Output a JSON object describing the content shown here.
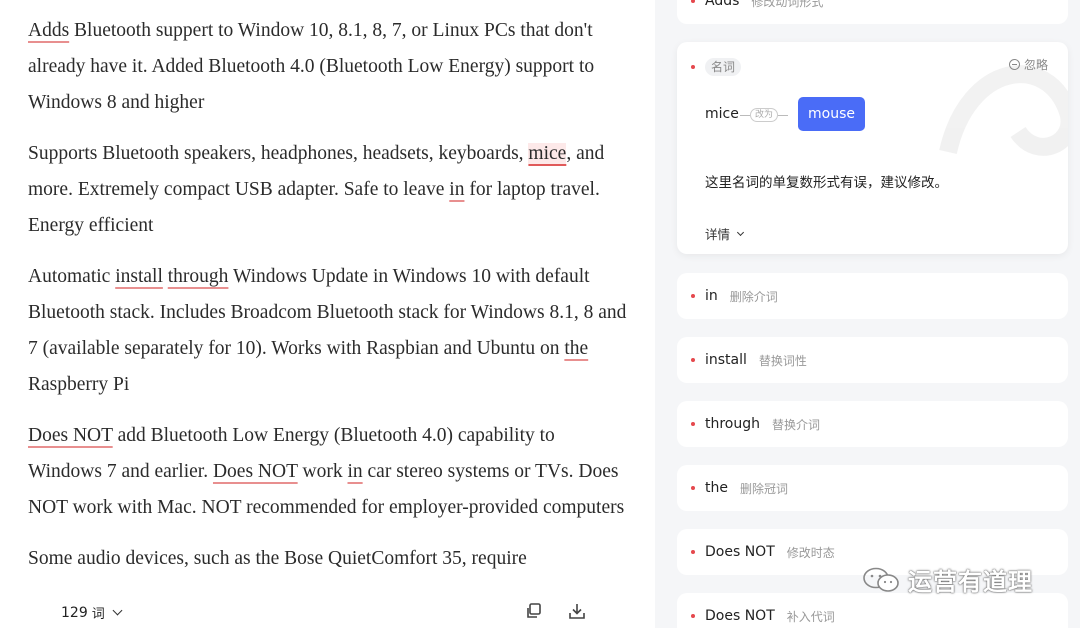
{
  "document": {
    "paragraphs": [
      [
        {
          "t": "Adds",
          "flag": true
        },
        {
          "t": " Bluetooth suppert to Window 10, 8.1, 8, 7, or Linux PCs that don't already have it. Added Bluetooth 4.0 (Bluetooth Low Energy) support to Windows 8 and higher"
        }
      ],
      [
        {
          "t": "Supports Bluetooth speakers, headphones, headsets, keyboards, "
        },
        {
          "t": "mice",
          "active": true
        },
        {
          "t": ", and more. Extremely compact USB adapter. Safe to leave "
        },
        {
          "t": "in",
          "flag": true
        },
        {
          "t": " for laptop travel. Energy efficient"
        }
      ],
      [
        {
          "t": "Automatic "
        },
        {
          "t": "install",
          "flag": true
        },
        {
          "t": " "
        },
        {
          "t": "through",
          "flag": true
        },
        {
          "t": " Windows Update in Windows 10 with default Bluetooth stack. Includes Broadcom Bluetooth stack for Windows 8.1, 8 and 7 (available separately for 10). Works with Raspbian and Ubuntu on "
        },
        {
          "t": "the",
          "flag": true
        },
        {
          "t": " Raspberry Pi"
        }
      ],
      [
        {
          "t": "Does NOT",
          "flag": true
        },
        {
          "t": " add Bluetooth Low Energy (Bluetooth 4.0) capability to Windows 7 and earlier. "
        },
        {
          "t": "Does NOT",
          "flag": true
        },
        {
          "t": " work "
        },
        {
          "t": "in",
          "flag": true
        },
        {
          "t": " car stereo systems or TVs. Does NOT work with Mac. NOT recommended for employer-provided computers"
        }
      ],
      [
        {
          "t": "Some audio devices, such as the Bose QuietComfort 35, require"
        }
      ]
    ]
  },
  "footer": {
    "word_count": "129",
    "word_unit": "词",
    "icons": [
      "copy-icon",
      "download-icon"
    ]
  },
  "suggestions": {
    "top_item": {
      "word": "Adds",
      "hint": "修改动词形式"
    },
    "active": {
      "tag": "名词",
      "ignore_label": "忽略",
      "from": "mice",
      "arrow_label": "改为",
      "to": "mouse",
      "description": "这里名词的单复数形式有误，建议修改。",
      "details_label": "详情"
    },
    "items": [
      {
        "word": "in",
        "hint": "删除介词"
      },
      {
        "word": "install",
        "hint": "替换词性"
      },
      {
        "word": "through",
        "hint": "替换介词"
      },
      {
        "word": "the",
        "hint": "删除冠词"
      },
      {
        "word": "Does NOT",
        "hint": "修改时态"
      },
      {
        "word": "Does NOT",
        "hint": "补入代词"
      }
    ]
  },
  "watermark": {
    "text": "运营有道理"
  },
  "colors": {
    "accent": "#4a6cf7",
    "error": "#e5484d",
    "panel_bg": "#f5f6f8"
  }
}
